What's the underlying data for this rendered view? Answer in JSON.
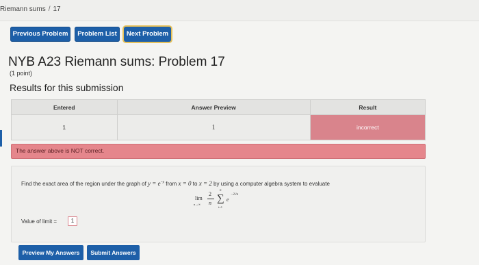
{
  "breadcrumb": {
    "parent": "Riemann sums",
    "separator": "/",
    "current": "17"
  },
  "nav": {
    "previous": "Previous Problem",
    "list": "Problem List",
    "next": "Next Problem"
  },
  "problem": {
    "title": "NYB A23 Riemann sums: Problem 17",
    "points": "(1 point)"
  },
  "results": {
    "heading": "Results for this submission",
    "columns": [
      "Entered",
      "Answer Preview",
      "Result"
    ],
    "rows": [
      {
        "entered": "1",
        "preview": "1",
        "result": "incorrect"
      }
    ],
    "message": "The answer above is NOT correct."
  },
  "question": {
    "text_before": "Find the exact area of the region under the graph of",
    "function": "y = e",
    "function_exp": "−x",
    "text_mid": "from",
    "from": "x = 0",
    "to_word": "to",
    "to": "x = 2",
    "text_after": "by using a computer algebra system to evaluate",
    "formula": {
      "lim": "lim",
      "lim_sub": "n→∞",
      "frac_num": "2",
      "frac_den": "n",
      "sigma": "∑",
      "sigma_top": "n",
      "sigma_bottom": "i=1",
      "base": "e",
      "exponent": "−2i/n"
    },
    "limit_label": "Value of limit =",
    "limit_value": "1"
  },
  "actions": {
    "preview": "Preview My Answers",
    "submit": "Submit Answers"
  },
  "colors": {
    "button": "#1d5fa8",
    "incorrect": "#d9848c",
    "alert": "#e5868c"
  }
}
